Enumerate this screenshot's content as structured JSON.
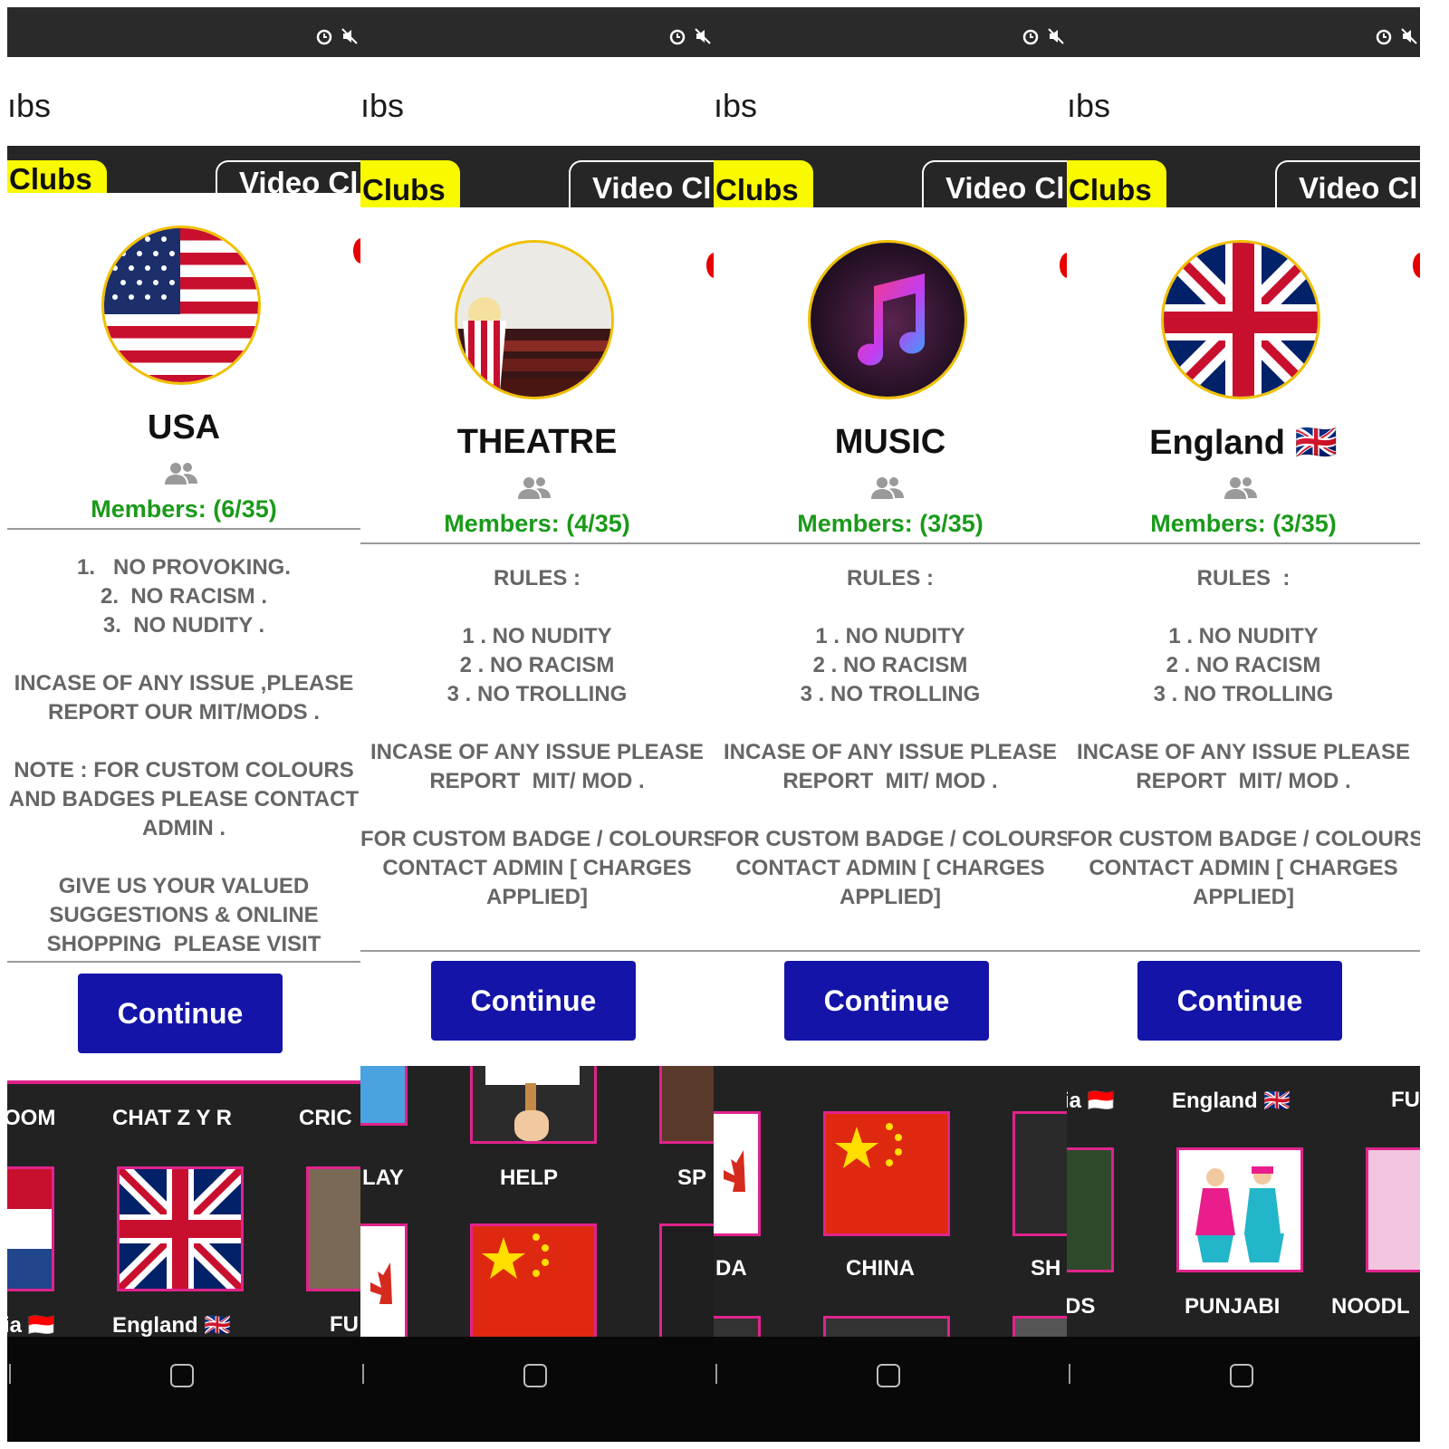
{
  "shared": {
    "title_fragment": "ıbs",
    "tab_clubs": "Clubs",
    "tab_video": "Video Cl",
    "continue": "Continue"
  },
  "panels": [
    {
      "club_name": "USA",
      "members": "Members: (6/35)",
      "rules": "1.   NO PROVOKING.\n2.  NO RACISM .\n3.  NO NUDITY .\n\nINCASE OF ANY ISSUE ,PLEASE\nREPORT OUR MIT/MODS .\n\nNOTE : FOR CUSTOM COLOURS\nAND BADGES PLEASE CONTACT\nADMIN .\n\nGIVE US YOUR VALUED\nSUGGESTIONS & ONLINE\nSHOPPING  PLEASE VISIT\nWWW.CHATZYR.NET RULES",
      "grid_labels": [
        "OOM",
        "CHAT Z Y R",
        "CRIC",
        "ia 🇮🇩",
        "England 🇬🇧",
        "FU"
      ]
    },
    {
      "club_name": "THEATRE",
      "members": "Members: (4/35)",
      "rules": "RULES :\n\n1 . NO NUDITY\n2 . NO RACISM\n3 . NO TROLLING\n\nINCASE OF ANY ISSUE PLEASE\nREPORT  MIT/ MOD .\n\nFOR CUSTOM BADGE / COLOURS\nCONTACT ADMIN [ CHARGES\nAPPLIED]",
      "grid_labels": [
        "LAY",
        "HELP",
        "SP"
      ]
    },
    {
      "club_name": "MUSIC",
      "members": "Members: (3/35)",
      "rules": "RULES :\n\n1 . NO NUDITY\n2 . NO RACISM\n3 . NO TROLLING\n\nINCASE OF ANY ISSUE PLEASE\nREPORT  MIT/ MOD .\n\nFOR CUSTOM BADGE / COLOURS\nCONTACT ADMIN [ CHARGES\nAPPLIED]",
      "grid_labels": [
        "DA",
        "CHINA",
        "SH"
      ]
    },
    {
      "club_name": "England 🇬🇧",
      "members": "Members: (3/35)",
      "rules": "RULES  :\n\n1 . NO NUDITY\n2 . NO RACISM\n3 . NO TROLLING\n\nINCASE OF ANY ISSUE PLEASE\nREPORT  MIT/ MOD .\n\nFOR CUSTOM BADGE / COLOURS\nCONTACT ADMIN [ CHARGES\nAPPLIED]",
      "grid_labels": [
        "ia 🇮🇩",
        "England 🇬🇧",
        "FU",
        "DS",
        "PUNJABI",
        "NOODL"
      ]
    }
  ],
  "colors": {
    "tab_active": "#f9f900",
    "continue_bg": "#1414a8",
    "members_text": "#1a9a1a",
    "avatar_ring": "#f0c000",
    "grid_tile_border": "#e0238c"
  },
  "icons": [
    "alarm-icon",
    "mute-icon",
    "members-icon",
    "home-icon",
    "red-notification-dot"
  ]
}
